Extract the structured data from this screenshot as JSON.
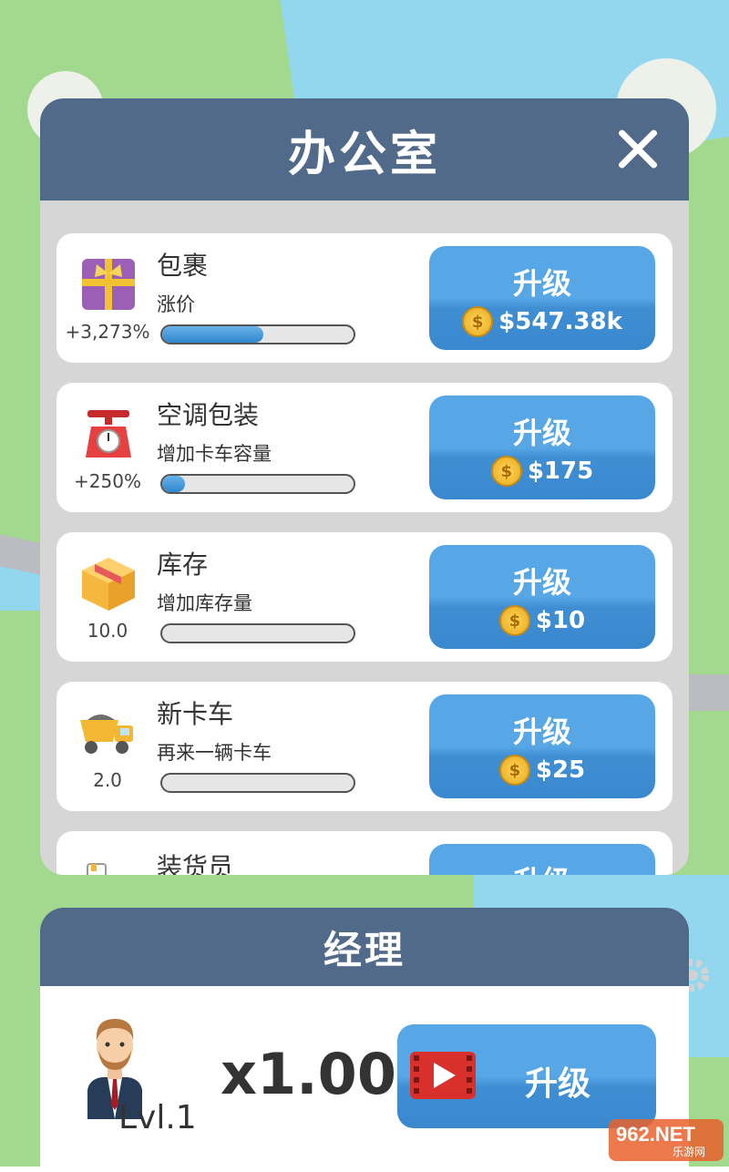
{
  "office": {
    "title": "办公室",
    "items": [
      {
        "icon": "gift-box-icon",
        "title": "包裹",
        "subtitle": "涨价",
        "stat": "+3,273%",
        "progress": 0.53,
        "button": "升级",
        "price": "$547.38k"
      },
      {
        "icon": "scale-icon",
        "title": "空调包装",
        "subtitle": "增加卡车容量",
        "stat": "+250%",
        "progress": 0.12,
        "button": "升级",
        "price": "$175"
      },
      {
        "icon": "cardboard-box-icon",
        "title": "库存",
        "subtitle": "增加库存量",
        "stat": "10.0",
        "progress": 0,
        "button": "升级",
        "price": "$10"
      },
      {
        "icon": "dump-truck-icon",
        "title": "新卡车",
        "subtitle": "再来一辆卡车",
        "stat": "2.0",
        "progress": 0,
        "button": "升级",
        "price": "$25"
      },
      {
        "icon": "loader-icon",
        "title": "装货员",
        "button": "升级"
      }
    ]
  },
  "manager": {
    "title": "经理",
    "level": "Lvl.1",
    "multiplier": "x1.00",
    "button": "升级"
  },
  "coin_symbol": "$",
  "watermark": "962.NET",
  "watermark_sub": "乐游网",
  "colors": {
    "header": "#526a8a",
    "button": "#4a9be0",
    "background": "#a3d88f",
    "river": "#93d7ef"
  }
}
